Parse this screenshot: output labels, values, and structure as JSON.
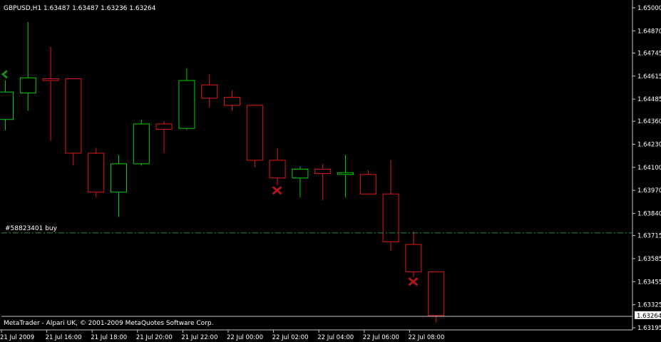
{
  "chart_data": {
    "type": "candlestick",
    "symbol_header": "GBPUSD,H1  1.63487 1.63487 1.63236 1.63264",
    "footer_text": "MetaTrader - Alpari UK, © 2001-2009 MetaQuotes Software Corp.",
    "ylim": [
      1.63195,
      1.65
    ],
    "y_ticks": [
      "1.65000",
      "1.64870",
      "1.64745",
      "1.64615",
      "1.64485",
      "1.64360",
      "1.64230",
      "1.64100",
      "1.63970",
      "1.63840",
      "1.63715",
      "1.63585",
      "1.63455",
      "1.63325",
      "1.63195"
    ],
    "current_price_label": "1.63264",
    "x_ticks": [
      "21 Jul 2009",
      "21 Jul 16:00",
      "21 Jul 18:00",
      "21 Jul 20:00",
      "21 Jul 22:00",
      "22 Jul 00:00",
      "22 Jul 02:00",
      "22 Jul 04:00",
      "22 Jul 06:00",
      "22 Jul 08:00"
    ],
    "candles": [
      {
        "o": 1.6437,
        "h": 1.6459,
        "l": 1.6431,
        "c": 1.64525
      },
      {
        "o": 1.6452,
        "h": 1.6492,
        "l": 1.6442,
        "c": 1.64605
      },
      {
        "o": 1.646,
        "h": 1.6478,
        "l": 1.6425,
        "c": 1.6459
      },
      {
        "o": 1.646,
        "h": 1.646,
        "l": 1.6411,
        "c": 1.6418
      },
      {
        "o": 1.6418,
        "h": 1.6421,
        "l": 1.6393,
        "c": 1.6396
      },
      {
        "o": 1.6396,
        "h": 1.6417,
        "l": 1.6382,
        "c": 1.6412
      },
      {
        "o": 1.6412,
        "h": 1.6437,
        "l": 1.6411,
        "c": 1.64345
      },
      {
        "o": 1.64345,
        "h": 1.6436,
        "l": 1.6418,
        "c": 1.64315
      },
      {
        "o": 1.6432,
        "h": 1.6466,
        "l": 1.6431,
        "c": 1.6459
      },
      {
        "o": 1.64565,
        "h": 1.64625,
        "l": 1.6444,
        "c": 1.6449
      },
      {
        "o": 1.64495,
        "h": 1.64535,
        "l": 1.6442,
        "c": 1.6445
      },
      {
        "o": 1.6445,
        "h": 1.6445,
        "l": 1.641,
        "c": 1.6414
      },
      {
        "o": 1.6414,
        "h": 1.6421,
        "l": 1.64,
        "c": 1.6404
      },
      {
        "o": 1.6404,
        "h": 1.64105,
        "l": 1.6393,
        "c": 1.6409
      },
      {
        "o": 1.6409,
        "h": 1.6412,
        "l": 1.63915,
        "c": 1.64065
      },
      {
        "o": 1.6406,
        "h": 1.6417,
        "l": 1.6393,
        "c": 1.6407
      },
      {
        "o": 1.6406,
        "h": 1.64085,
        "l": 1.6395,
        "c": 1.6395
      },
      {
        "o": 1.6395,
        "h": 1.6414,
        "l": 1.6363,
        "c": 1.6368
      },
      {
        "o": 1.63665,
        "h": 1.6374,
        "l": 1.6348,
        "c": 1.6351
      },
      {
        "o": 1.6351,
        "h": 1.6351,
        "l": 1.63225,
        "c": 1.63264
      }
    ],
    "order_line": {
      "price": 1.6373,
      "label": "#58823401 buy",
      "color": "#2f8f3f"
    },
    "arrows": [
      {
        "candle": 0,
        "price": 1.64625,
        "kind": "buy-mark",
        "color": "#1e8a1e"
      },
      {
        "candle": 12,
        "price": 1.6397,
        "kind": "close-mark",
        "color": "#b01818"
      },
      {
        "candle": 18,
        "price": 1.63455,
        "kind": "close-mark",
        "color": "#b01818"
      }
    ],
    "colors": {
      "bull": "#00d000",
      "bear": "#e01818",
      "axis": "#c8c8c8",
      "text": "#ffffff",
      "background": "#000000"
    },
    "grid": false
  }
}
